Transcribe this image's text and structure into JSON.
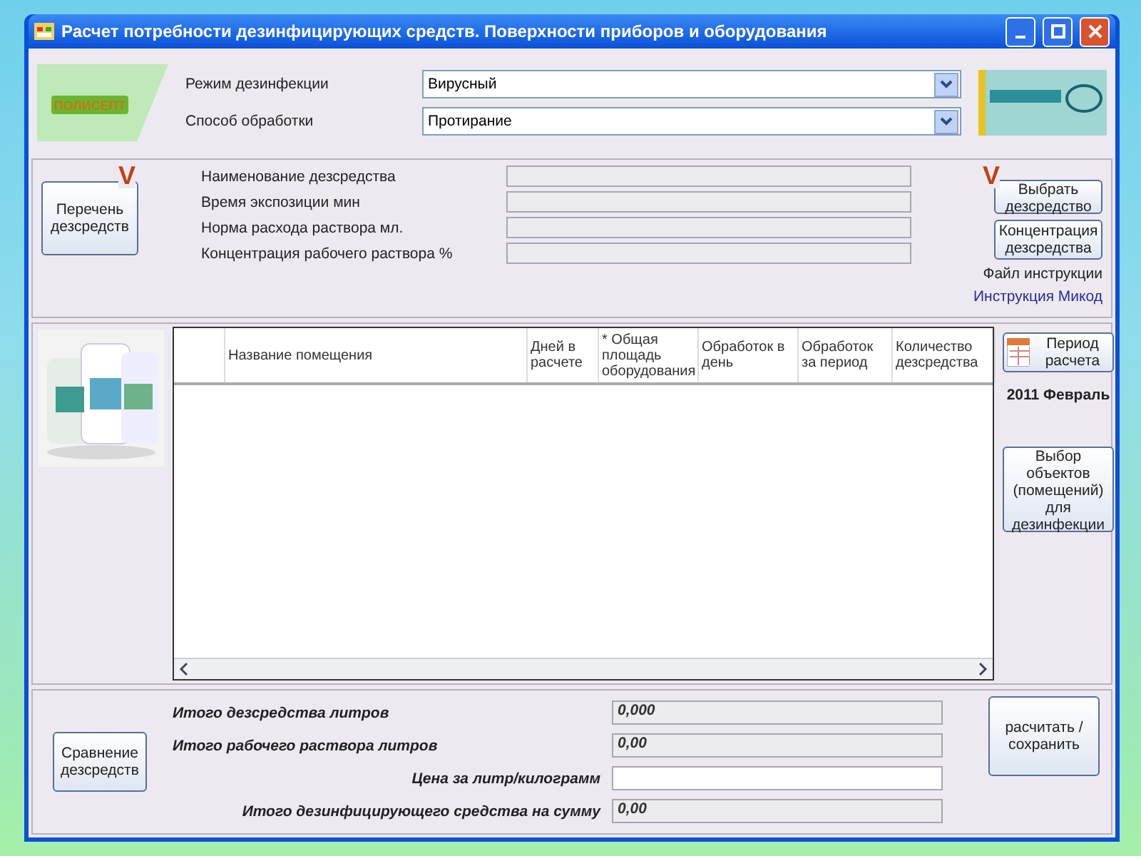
{
  "window": {
    "title": "Расчет потребности дезинфицирующих средств. Поверхности приборов и оборудования"
  },
  "logo": {
    "text": "ПОЛИСЕПТ"
  },
  "settings": [
    {
      "label": "Режим дезинфекции",
      "value": "Вирусный"
    },
    {
      "label": "Способ обработки",
      "value": "Протирание"
    }
  ],
  "product": {
    "list_button": "Перечень дезсредств",
    "mark": "V",
    "fields": [
      {
        "label": "Наименование  дезсредства"
      },
      {
        "label": "Время экспозиции мин"
      },
      {
        "label": "Норма расхода раствора мл."
      },
      {
        "label": "Концентрация рабочего раствора %"
      }
    ],
    "select_mark": "V",
    "select_button": "Выбрать дезсредство",
    "concentration_button": "Концентрация дезсредства",
    "instructions_label": "Файл инструкции",
    "instructions_link": "Инструкция Микод"
  },
  "table": {
    "columns": [
      "",
      "Название помещения",
      "Дней в расчете",
      "* Общая площадь оборудования",
      "Обработок в день",
      "Обработок за период",
      "Количество дезсредства"
    ]
  },
  "period": {
    "button": "Период расчета",
    "value": "2011 Февраль"
  },
  "objects_button": "Выбор объектов (помещений) для дезинфекции",
  "totals": {
    "compare_button": "Сравнение дезсредств",
    "rows": [
      {
        "label": "Итого дезсредства литров",
        "value": "0,000",
        "editable": false
      },
      {
        "label": "Итого рабочего раствора литров",
        "value": "0,00",
        "editable": false
      },
      {
        "label": "Цена за литр/килограмм",
        "value": "",
        "editable": true
      },
      {
        "label": "Итого дезинфицирующего средства на сумму",
        "value": "0,00",
        "editable": false
      }
    ],
    "calculate_button": "расчитать / сохранить"
  }
}
